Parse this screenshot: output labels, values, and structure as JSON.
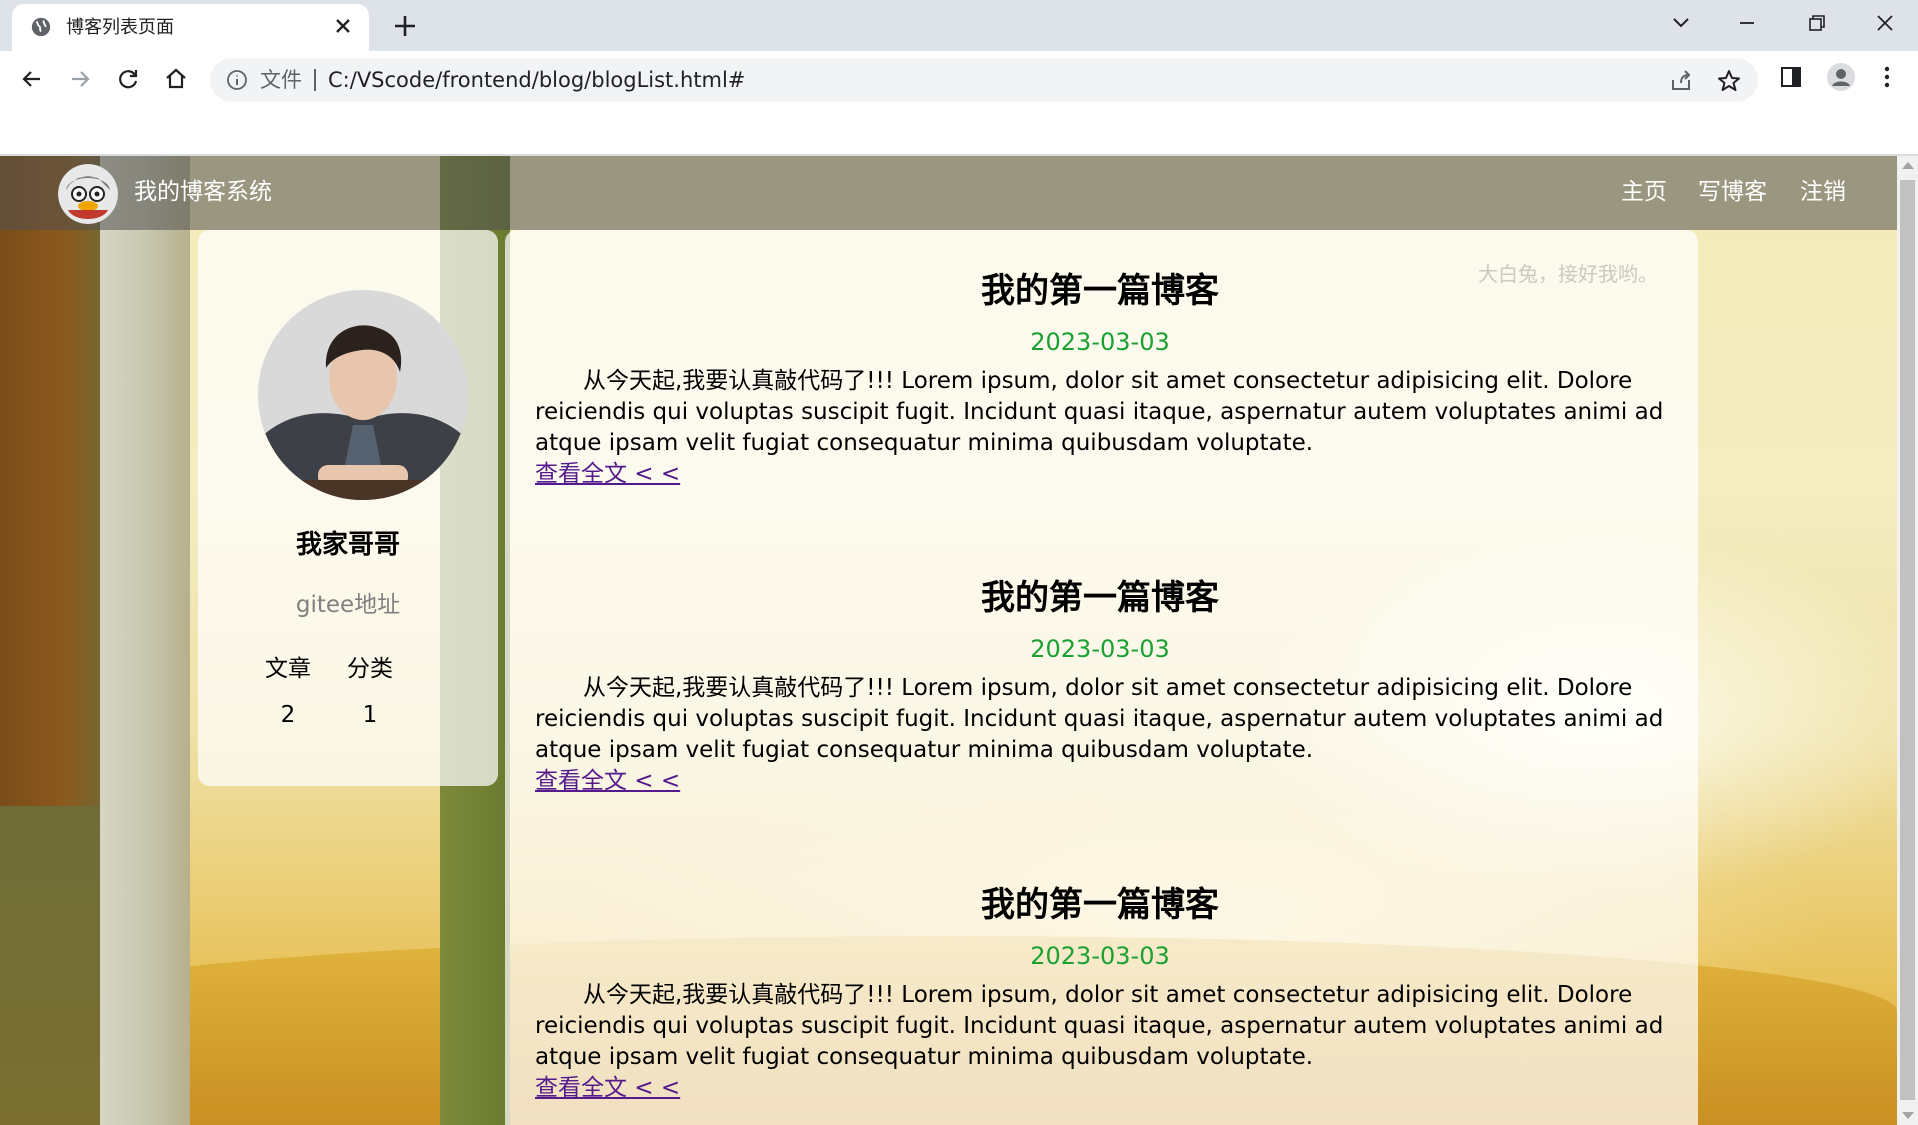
{
  "browser": {
    "tab_title": "博客列表页面",
    "address_scheme_label": "文件",
    "url": "C:/VScode/frontend/blog/blogList.html#"
  },
  "icons": {
    "favicon": "globe-icon",
    "tab_close": "close-icon",
    "new_tab": "plus-icon",
    "back": "back-arrow-icon",
    "forward": "forward-arrow-icon",
    "reload": "reload-icon",
    "home": "home-icon",
    "site_info": "info-icon",
    "share": "share-icon",
    "bookmark": "star-icon",
    "side_panel": "side-panel-icon",
    "profile": "profile-icon",
    "menu": "kebab-menu-icon"
  },
  "navbar": {
    "site_title": "我的博客系统",
    "links": [
      "主页",
      "写博客",
      "注销"
    ]
  },
  "profile": {
    "name": "我家哥哥",
    "gitee": "gitee地址",
    "stats": [
      {
        "label": "文章",
        "value": "2"
      },
      {
        "label": "分类",
        "value": "1"
      }
    ]
  },
  "watermark": "大白兔，接好我哟。",
  "blogs": [
    {
      "title": "我的第一篇博客",
      "date": "2023-03-03",
      "desc": "从今天起,我要认真敲代码了!!! Lorem ipsum, dolor sit amet consectetur adipisicing elit. Dolore reiciendis qui voluptas suscipit fugit. Incidunt quasi itaque, aspernatur autem voluptates animi ad atque ipsam velit fugiat consequatur minima quibusdam voluptate.",
      "more": "查看全文 < <"
    },
    {
      "title": "我的第一篇博客",
      "date": "2023-03-03",
      "desc": "从今天起,我要认真敲代码了!!! Lorem ipsum, dolor sit amet consectetur adipisicing elit. Dolore reiciendis qui voluptas suscipit fugit. Incidunt quasi itaque, aspernatur autem voluptates animi ad atque ipsam velit fugiat consequatur minima quibusdam voluptate.",
      "more": "查看全文 < <"
    },
    {
      "title": "我的第一篇博客",
      "date": "2023-03-03",
      "desc": "从今天起,我要认真敲代码了!!! Lorem ipsum, dolor sit amet consectetur adipisicing elit. Dolore reiciendis qui voluptas suscipit fugit. Incidunt quasi itaque, aspernatur autem voluptates animi ad atque ipsam velit fugiat consequatur minima quibusdam voluptate.",
      "more": "查看全文 < <"
    }
  ],
  "colors": {
    "date": "#1aa033",
    "link": "#551a8b",
    "navbar_text": "#ffffff"
  }
}
